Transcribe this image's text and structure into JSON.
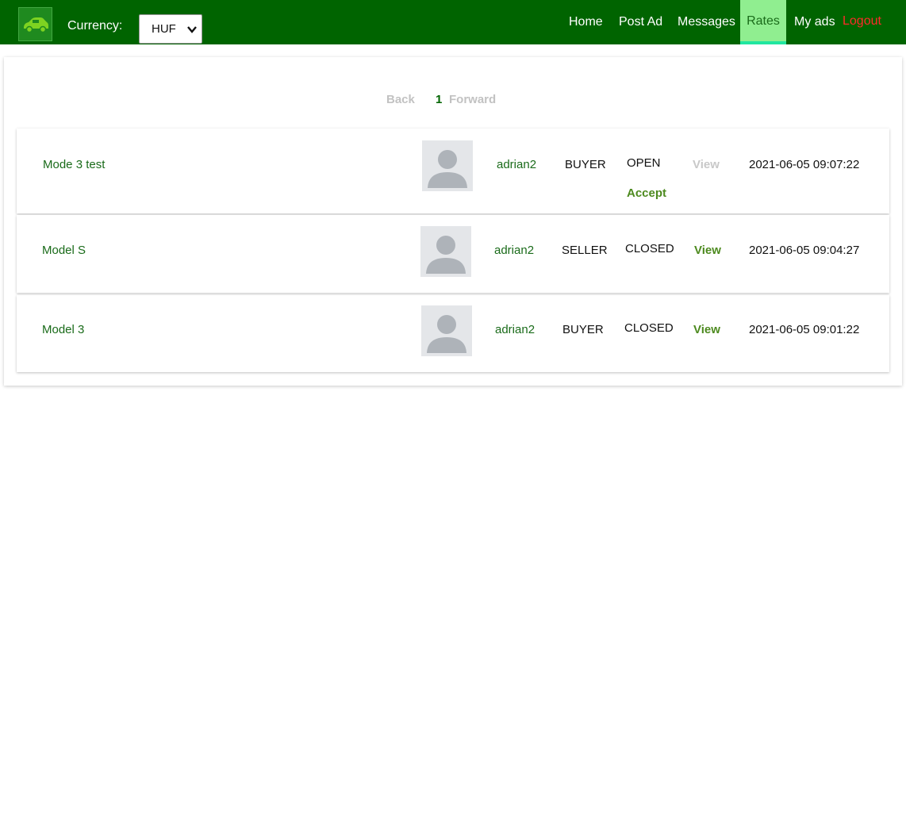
{
  "header": {
    "logo_icon": "car-icon",
    "currency_label": "Currency:",
    "currency_selected": "HUF",
    "nav": {
      "home": "Home",
      "post_ad": "Post Ad",
      "messages": "Messages",
      "rates": "Rates",
      "my_ads": "My ads",
      "logout": "Logout"
    },
    "colors": {
      "navbar": "#006400",
      "active_tab": "#90ee90",
      "logout": "#ff2a2a"
    }
  },
  "pager": {
    "back": "Back",
    "current_page": "1",
    "forward": "Forward"
  },
  "rates": [
    {
      "ad_title": "Mode 3 test",
      "user": "adrian2",
      "role": "BUYER",
      "status": "OPEN",
      "view": "View",
      "view_enabled": false,
      "accept": "Accept",
      "date": "2021-06-05 09:07:22"
    },
    {
      "ad_title": "Model S",
      "user": "adrian2",
      "role": "SELLER",
      "status": "CLOSED",
      "view": "View",
      "view_enabled": true,
      "date": "2021-06-05 09:04:27"
    },
    {
      "ad_title": "Model 3",
      "user": "adrian2",
      "role": "BUYER",
      "status": "CLOSED",
      "view": "View",
      "view_enabled": true,
      "date": "2021-06-05 09:01:22"
    }
  ]
}
